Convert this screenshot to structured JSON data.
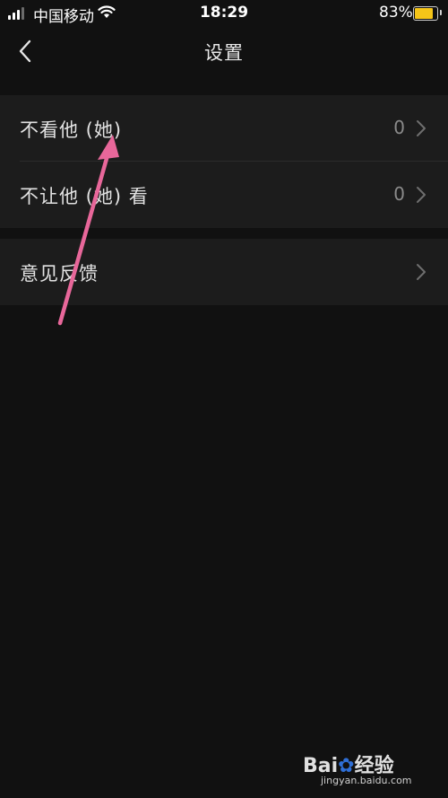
{
  "status_bar": {
    "carrier": "中国移动",
    "time": "18:29",
    "battery_percent": "83%",
    "battery_level": 0.83,
    "signal_bars": 4,
    "signal_active": 3
  },
  "nav": {
    "title": "设置",
    "back_icon": "chevron-left-icon"
  },
  "settings": {
    "items": [
      {
        "label": "不看他 (她)",
        "value": "0"
      },
      {
        "label": "不让他 (她) 看",
        "value": "0"
      }
    ],
    "feedback": {
      "label": "意见反馈"
    }
  },
  "colors": {
    "background": "#111111",
    "row_background": "#1c1c1c",
    "arrow": "#e8679a",
    "battery": "#f5c518"
  },
  "watermark": {
    "brand_left": "Bai",
    "brand_right": "经验",
    "subtitle": "jingyan.baidu.com"
  }
}
